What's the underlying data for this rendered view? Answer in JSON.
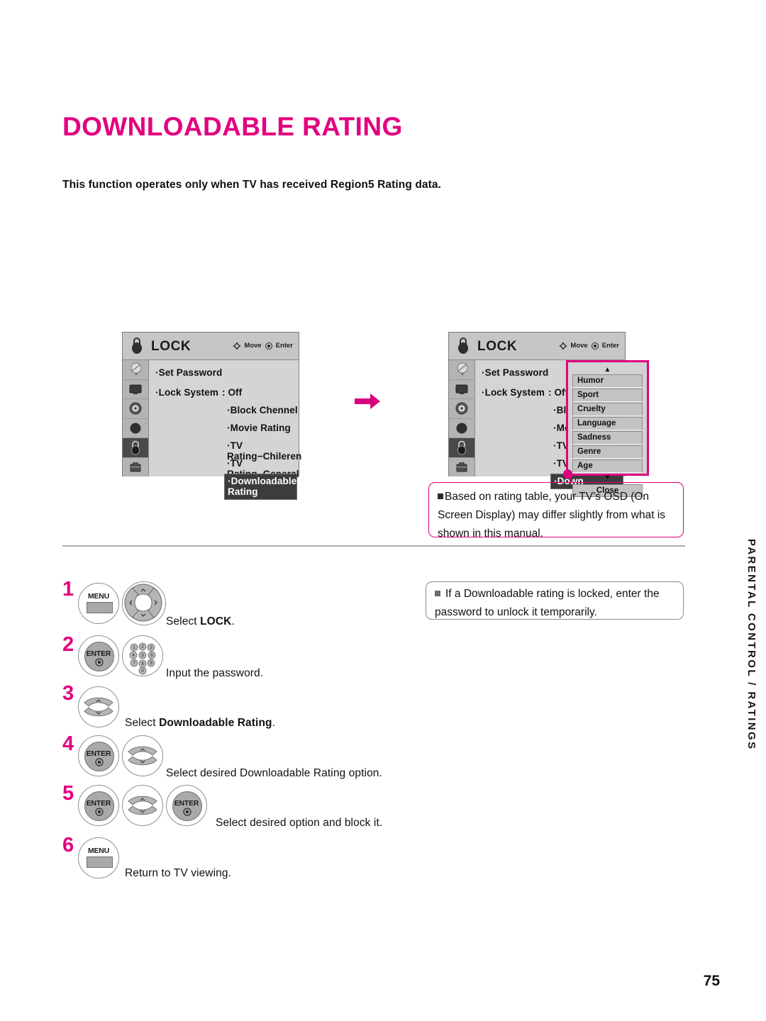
{
  "page": {
    "title": "DOWNLOADABLE RATING",
    "intro": "This function operates only when TV has received Region5 Rating data.",
    "side_label": "PARENTAL CONTROL / RATINGS",
    "page_number": "75",
    "accent_color": "#e2007f"
  },
  "osd_left": {
    "title": "LOCK",
    "hint_move": "Move",
    "hint_enter": "Enter",
    "rail_icons": [
      "antenna-icon",
      "picture-icon",
      "audio-icon",
      "time-icon",
      "lock-icon",
      "setup-icon"
    ],
    "items": [
      {
        "label": "·Set Password",
        "level": 1
      },
      {
        "label": "·Lock System",
        "level": 1
      },
      {
        "label": ": Off",
        "level": 2
      },
      {
        "label": "·Block Chennel",
        "level": 2
      },
      {
        "label": "·Movie Rating",
        "level": 2
      },
      {
        "label": "·TV Rating−Chileren",
        "level": 2
      },
      {
        "label": "·TV Rating−General",
        "level": 2
      },
      {
        "label": "·Downloadable Rating",
        "level": 2,
        "selected": true
      }
    ]
  },
  "osd_right": {
    "title": "LOCK",
    "hint_move": "Move",
    "hint_enter": "Enter",
    "items": [
      {
        "label": "·Set Password",
        "level": 1
      },
      {
        "label": "·Lock System",
        "level": 1
      },
      {
        "label": ": Off",
        "level": 2
      },
      {
        "label": "·Block",
        "level": 2
      },
      {
        "label": "·Movie",
        "level": 2
      },
      {
        "label": "·TV Ra",
        "level": 2
      },
      {
        "label": "·TV Ra",
        "level": 2
      },
      {
        "label": "·Down",
        "level": 2,
        "selected": true
      }
    ],
    "dropdown": {
      "scroll_up": "▲",
      "scroll_down": "▼",
      "options": [
        "Humor",
        "Sport",
        "Cruelty",
        "Language",
        "Sadness",
        "Genre",
        "Age"
      ],
      "close_label": "Close"
    }
  },
  "notes": [
    {
      "id": "osd-note",
      "style": "pink",
      "text": "Based on rating table, your TV’s OSD (On Screen Display) may differ slightly from what is shown in this manual."
    },
    {
      "id": "locked-note",
      "style": "gray",
      "text": "If a Downloadable rating is locked, enter the password to unlock it temporarily."
    }
  ],
  "steps": [
    {
      "num": "1",
      "buttons": [
        "MENU",
        "nav-pad"
      ],
      "text_plain": "Select ",
      "text_bold": "LOCK",
      "text_tail": "."
    },
    {
      "num": "2",
      "buttons": [
        "ENTER",
        "number-keypad"
      ],
      "text_plain": "Input the password.",
      "text_bold": "",
      "text_tail": ""
    },
    {
      "num": "3",
      "buttons": [
        "updown"
      ],
      "text_plain": "Select ",
      "text_bold": "Downloadable Rating",
      "text_tail": "."
    },
    {
      "num": "4",
      "buttons": [
        "ENTER",
        "updown"
      ],
      "text_plain": "Select desired Downloadable Rating option.",
      "text_bold": "",
      "text_tail": ""
    },
    {
      "num": "5",
      "buttons": [
        "ENTER",
        "updown",
        "ENTER"
      ],
      "text_plain": "Select desired option and block it.",
      "text_bold": "",
      "text_tail": ""
    },
    {
      "num": "6",
      "buttons": [
        "MENU"
      ],
      "text_plain": "Return to TV viewing.",
      "text_bold": "",
      "text_tail": ""
    }
  ],
  "labels": {
    "menu": "MENU",
    "enter": "ENTER",
    "keypad": [
      "1",
      "2",
      "3",
      "4",
      "5",
      "6",
      "7",
      "8",
      "9",
      "0"
    ]
  }
}
